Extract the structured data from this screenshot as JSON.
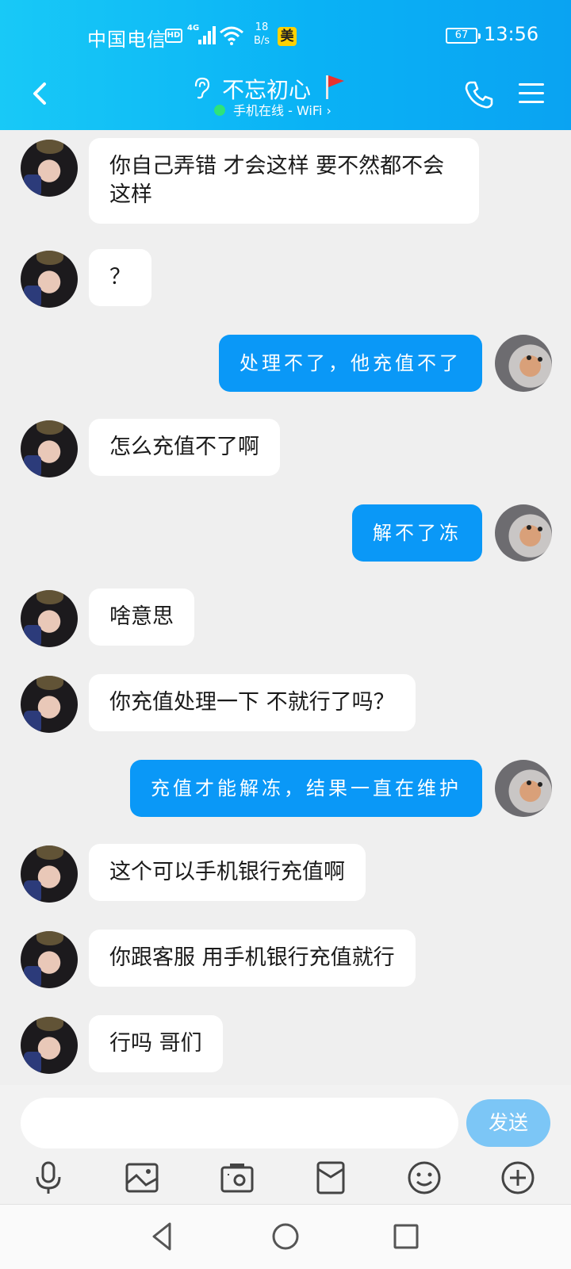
{
  "status_bar": {
    "carrier": "中国电信",
    "hd": "HD",
    "network": "4G",
    "net_speed_value": "18",
    "net_speed_unit": "B/s",
    "app_badge": "美",
    "battery": "67",
    "time": "13:56"
  },
  "header": {
    "title": "不忘初心",
    "status": "手机在线 - WiFi",
    "status_chevron": "›",
    "icons": [
      "back-icon",
      "ear-icon",
      "flag-icon",
      "phone-icon",
      "menu-icon"
    ],
    "accent": "#0aa8f4"
  },
  "messages": [
    {
      "side": "in",
      "text": "你自己弄错 才会这样 要不然都不会这样"
    },
    {
      "side": "in",
      "text": "？"
    },
    {
      "side": "out",
      "text": "处理不了，他充值不了"
    },
    {
      "side": "in",
      "text": "怎么充值不了啊"
    },
    {
      "side": "out",
      "text": "解不了冻"
    },
    {
      "side": "in",
      "text": "啥意思"
    },
    {
      "side": "in",
      "text": "你充值处理一下 不就行了吗？"
    },
    {
      "side": "out",
      "text": "充值才能解冻，结果一直在维护"
    },
    {
      "side": "in",
      "text": "这个可以手机银行充值啊"
    },
    {
      "side": "in",
      "text": "你跟客服 用手机银行充值就行"
    },
    {
      "side": "in",
      "text": "行吗 哥们"
    }
  ],
  "input": {
    "value": "",
    "placeholder": "",
    "send_label": "发送"
  },
  "toolbar": [
    "microphone-icon",
    "image-icon",
    "camera-icon",
    "red-packet-icon",
    "emoji-icon",
    "plus-icon"
  ],
  "nav": [
    "back-nav-icon",
    "home-nav-icon",
    "recents-nav-icon"
  ],
  "colors": {
    "outgoing_bubble": "#0a98f7",
    "incoming_bubble": "#ffffff",
    "send_button": "#7cc6f6",
    "online_dot": "#2ee37a"
  }
}
